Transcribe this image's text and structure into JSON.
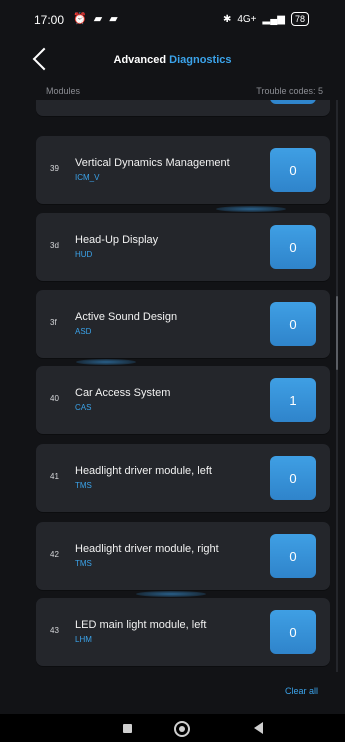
{
  "status_bar": {
    "time": "17:00",
    "left_icons": "⏰ ▰ ▰",
    "network": "4G+",
    "battery": "78"
  },
  "header": {
    "title_part1": "Advanced",
    "title_part2": "Diagnostics"
  },
  "subheader": {
    "modules_label": "Modules",
    "trouble_codes": "Trouble codes: 5"
  },
  "modules": [
    {
      "code": "39",
      "name": "Vertical Dynamics Management",
      "abbr": "ICM_V",
      "count": "0"
    },
    {
      "code": "3d",
      "name": "Head-Up Display",
      "abbr": "HUD",
      "count": "0"
    },
    {
      "code": "3f",
      "name": "Active Sound Design",
      "abbr": "ASD",
      "count": "0"
    },
    {
      "code": "40",
      "name": "Car Access System",
      "abbr": "CAS",
      "count": "1"
    },
    {
      "code": "41",
      "name": "Headlight driver module, left",
      "abbr": "TMS",
      "count": "0"
    },
    {
      "code": "42",
      "name": "Headlight driver module, right",
      "abbr": "TMS",
      "count": "0"
    },
    {
      "code": "43",
      "name": "LED main light module, left",
      "abbr": "LHM",
      "count": "0"
    }
  ],
  "footer": {
    "clear_all": "Clear all"
  },
  "colors": {
    "accent": "#3ba3ea",
    "card": "#24262b",
    "background": "#121316"
  }
}
